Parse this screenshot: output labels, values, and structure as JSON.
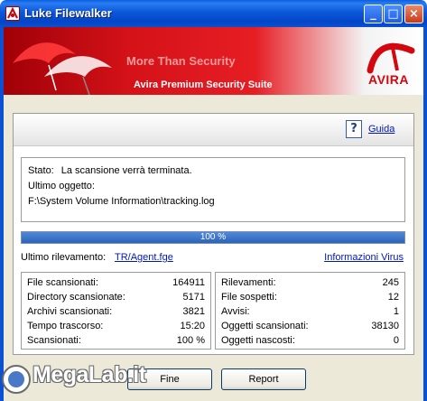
{
  "window": {
    "title": "Luke Filewalker",
    "minimize_glyph": "_",
    "maximize_glyph": "□",
    "close_glyph": "×"
  },
  "banner": {
    "tagline": "More Than Security",
    "product": "Avira Premium Security Suite",
    "logo_text": "AVIRA",
    "colors": {
      "brand_red": "#d4060e"
    }
  },
  "header": {
    "help_icon": "help-book-icon",
    "help_link": "Guida"
  },
  "status": {
    "state_label": "Stato:",
    "state_value": "La scansione verrà terminata.",
    "last_object_label": "Ultimo oggetto:",
    "last_object_path": "F:\\System Volume Information\\tracking.log"
  },
  "progress": {
    "label": "100 %",
    "value": 100
  },
  "detection": {
    "label": "Ultimo rilevamento:",
    "value": "TR/Agent.fge",
    "info_link": "Informazioni Virus"
  },
  "stats_left": [
    {
      "label": "File scansionati:",
      "value": "164911"
    },
    {
      "label": "Directory scansionate:",
      "value": "5171"
    },
    {
      "label": "Archivi scansionati:",
      "value": "3821"
    },
    {
      "label": "Tempo trascorso:",
      "value": "15:20"
    },
    {
      "label": "Scansionati:",
      "value": "100 %"
    }
  ],
  "stats_right": [
    {
      "label": "Rilevamenti:",
      "value": "245"
    },
    {
      "label": "File sospetti:",
      "value": "12"
    },
    {
      "label": "Avvisi:",
      "value": "1"
    },
    {
      "label": "Oggetti scansionati:",
      "value": "38130"
    },
    {
      "label": "Oggetti nascosti:",
      "value": "0"
    }
  ],
  "buttons": {
    "fine": "Fine",
    "report": "Report"
  },
  "watermark": {
    "text": "MegaLab.it"
  }
}
